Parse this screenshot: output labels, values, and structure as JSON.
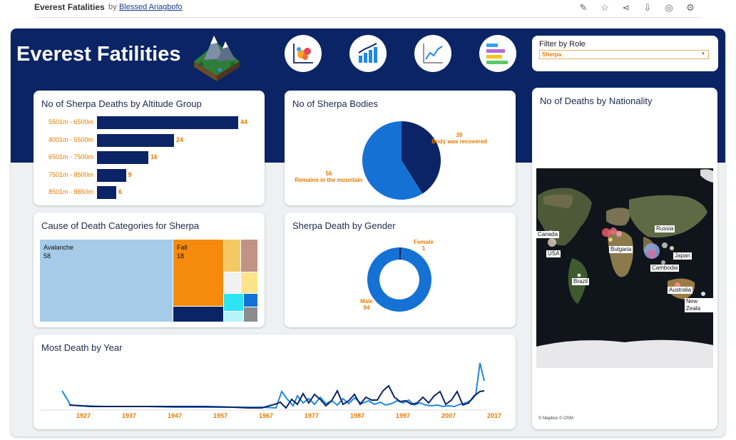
{
  "header": {
    "viz_title": "Everest Fatalities",
    "by": "by",
    "author": "Blessed Ariagbofo",
    "icons": [
      "edit-icon",
      "star-icon",
      "share-icon",
      "download-icon",
      "badge-icon",
      "settings-icon"
    ]
  },
  "dashboard": {
    "title": "Everest Fatilities",
    "nav_buttons": [
      "bubble-chart-icon",
      "bar-chart-icon",
      "line-chart-icon",
      "gantt-chart-icon"
    ],
    "filter": {
      "label": "Filter by Role",
      "value": "Sherpa"
    }
  },
  "altitude": {
    "title": "No of Sherpa Deaths by Altitude Group",
    "chart_data": {
      "type": "bar",
      "categories": [
        "5501m - 6500m",
        "4001m - 5500m",
        "6501m - 7500m",
        "7501m - 8500m",
        "8501m - 8850m"
      ],
      "values": [
        44,
        24,
        16,
        9,
        6
      ]
    }
  },
  "bodies": {
    "title": "No of Sherpa Bodies",
    "chart_data": {
      "type": "pie",
      "slices": [
        {
          "label": "Body was recovered",
          "value": 39,
          "color": "#0b2466"
        },
        {
          "label": "Remains in the mountain",
          "value": 56,
          "color": "#1572d4"
        }
      ]
    }
  },
  "causes": {
    "title": "Cause of Death Categories for Sherpa",
    "chart_data": {
      "type": "treemap",
      "items": [
        {
          "label": "Avalanche",
          "value": 58,
          "color": "#a5cbe9"
        },
        {
          "label": "Fall",
          "value": 18,
          "color": "#f58a0d"
        }
      ]
    }
  },
  "gender": {
    "title": "Sherpa Death by Gender",
    "chart_data": {
      "type": "pie",
      "slices": [
        {
          "label": "Female",
          "value": 1,
          "color": "#0b2466"
        },
        {
          "label": "Male",
          "value": 94,
          "color": "#1572d4"
        }
      ]
    }
  },
  "nationality": {
    "title": "No of Deaths by Nationality",
    "countries": [
      "Canada",
      "USA",
      "Brazil",
      "Bulgaria",
      "Russia",
      "Japan",
      "Cambodia",
      "Australia",
      "New Zeala"
    ],
    "attribution": "© Mapbox  © OSM"
  },
  "years": {
    "title": "Most Death by Year",
    "chart_data": {
      "type": "line",
      "x_ticks": [
        "1927",
        "1937",
        "1947",
        "1957",
        "1967",
        "1977",
        "1987",
        "1997",
        "2007",
        "2017"
      ]
    }
  }
}
